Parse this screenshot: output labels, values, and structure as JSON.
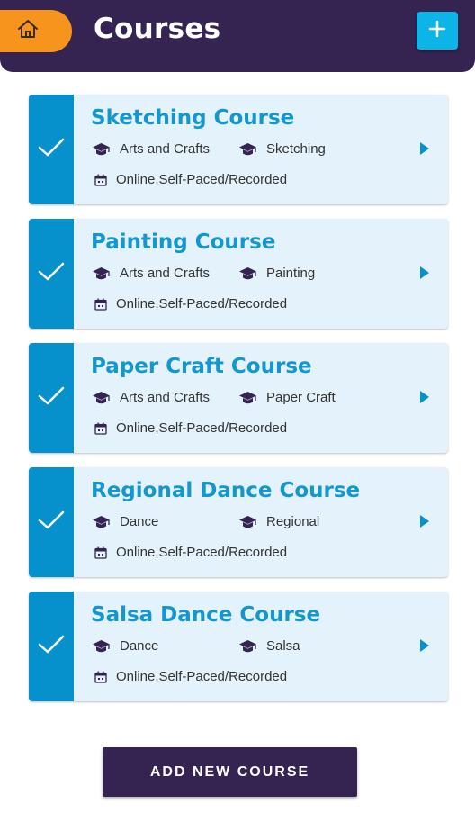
{
  "header": {
    "title": "Courses",
    "home_icon": "home-icon",
    "add_icon": "plus-icon"
  },
  "colors": {
    "header_bg": "#352452",
    "home_button": "#f7941d",
    "add_button": "#0db4e8",
    "card_accent": "#0690cc",
    "card_bg": "#e3f2fb",
    "title_text": "#1496cf"
  },
  "courses": [
    {
      "title": "Sketching Course",
      "category": "Arts and Crafts",
      "subcategory": "Sketching",
      "format": "Online,Self-Paced/Recorded"
    },
    {
      "title": "Painting Course",
      "category": "Arts and Crafts",
      "subcategory": "Painting",
      "format": "Online,Self-Paced/Recorded"
    },
    {
      "title": "Paper Craft Course",
      "category": "Arts and Crafts",
      "subcategory": "Paper Craft",
      "format": "Online,Self-Paced/Recorded"
    },
    {
      "title": "Regional Dance Course",
      "category": "Dance",
      "subcategory": "Regional",
      "format": "Online,Self-Paced/Recorded"
    },
    {
      "title": "Salsa Dance Course",
      "category": "Dance",
      "subcategory": "Salsa",
      "format": "Online,Self-Paced/Recorded"
    }
  ],
  "footer": {
    "add_course_label": "ADD NEW COURSE"
  }
}
